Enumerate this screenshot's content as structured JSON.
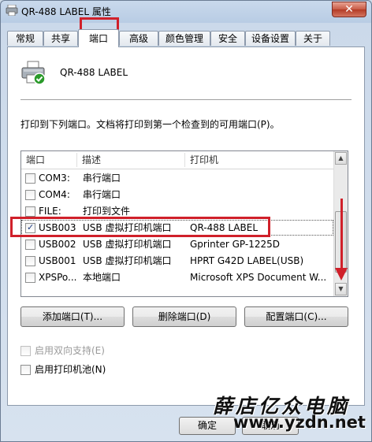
{
  "window": {
    "title": "QR-488 LABEL 属性",
    "close_label": "✕"
  },
  "tabs": [
    {
      "label": "常规"
    },
    {
      "label": "共享"
    },
    {
      "label": "端口"
    },
    {
      "label": "高级"
    },
    {
      "label": "颜色管理"
    },
    {
      "label": "安全"
    },
    {
      "label": "设备设置"
    },
    {
      "label": "关于"
    }
  ],
  "active_tab": "端口",
  "printer": {
    "name": "QR-488 LABEL",
    "icon": "printer-icon"
  },
  "instruction": "打印到下列端口。文档将打印到第一个检查到的可用端口(P)。",
  "ports": {
    "columns": [
      "端口",
      "描述",
      "打印机"
    ],
    "rows": [
      {
        "port": "COM3:",
        "desc": "串行端口",
        "printer": "",
        "checked": false
      },
      {
        "port": "COM4:",
        "desc": "串行端口",
        "printer": "",
        "checked": false
      },
      {
        "port": "FILE:",
        "desc": "打印到文件",
        "printer": "",
        "checked": false
      },
      {
        "port": "USB003",
        "desc": "USB 虚拟打印机端口",
        "printer": "QR-488 LABEL",
        "checked": true
      },
      {
        "port": "USB002",
        "desc": "USB 虚拟打印机端口",
        "printer": "Gprinter  GP-1225D",
        "checked": false
      },
      {
        "port": "USB001",
        "desc": "USB 虚拟打印机端口",
        "printer": "HPRT G42D LABEL(USB)",
        "checked": false
      },
      {
        "port": "XPSPo...",
        "desc": "本地端口",
        "printer": "Microsoft XPS Document W...",
        "checked": false
      }
    ]
  },
  "buttons": {
    "add": "添加端口(T)...",
    "delete": "删除端口(D)",
    "configure": "配置端口(C)..."
  },
  "options": {
    "bidirectional": {
      "label": "启用双向支持(E)",
      "checked": false,
      "disabled": true
    },
    "pooling": {
      "label": "启用打印机池(N)",
      "checked": false,
      "disabled": false
    }
  },
  "footer": {
    "ok": "确定",
    "cancel": "取消"
  },
  "watermark": {
    "text": "薛店亿众电脑",
    "url": "www.yzdn.net"
  },
  "colors": {
    "highlight": "#d0202a",
    "accent": "#2a9a2a"
  }
}
